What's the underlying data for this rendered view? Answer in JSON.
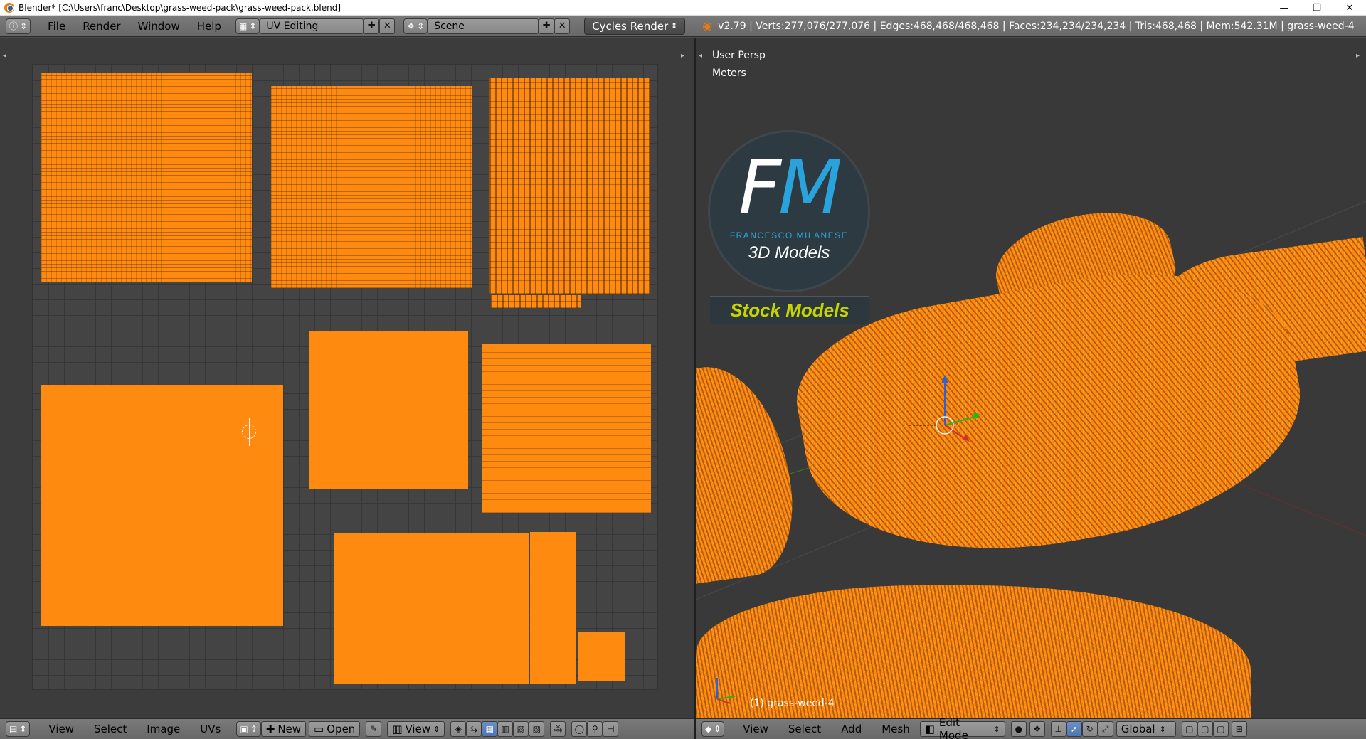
{
  "window": {
    "title": "Blender* [C:\\Users\\franc\\Desktop\\grass-weed-pack\\grass-weed-pack.blend]",
    "minimize": "—",
    "maximize": "❐",
    "close": "✕"
  },
  "info_header": {
    "menus": [
      "File",
      "Render",
      "Window",
      "Help"
    ],
    "screen_layout": "UV Editing",
    "scene": "Scene",
    "render_engine": "Cycles Render",
    "stats": "v2.79 | Verts:277,076/277,076 | Edges:468,468/468,468 | Faces:234,234/234,234 | Tris:468,468 | Mem:542.31M | grass-weed-4"
  },
  "uv_editor": {
    "footer": {
      "menus": [
        "View",
        "Select",
        "Image",
        "UVs"
      ],
      "new_label": "New",
      "open_label": "Open",
      "view_label": "View"
    }
  },
  "viewport": {
    "view_name": "User Persp",
    "units": "Meters",
    "object_label": "(1) grass-weed-4",
    "logo": {
      "letter_f": "F",
      "letter_m": "M",
      "author": "FRANCESCO MILANESE",
      "subtitle": "3D Models",
      "badge": "Stock Models"
    },
    "footer": {
      "menus": [
        "View",
        "Select",
        "Add",
        "Mesh"
      ],
      "mode": "Edit Mode",
      "orientation": "Global"
    }
  },
  "colors": {
    "uv_island": "#ff8a10",
    "selected_accent": "#4e76b2",
    "logo_blue": "#29a3db",
    "badge_yellow": "#c6d400"
  }
}
